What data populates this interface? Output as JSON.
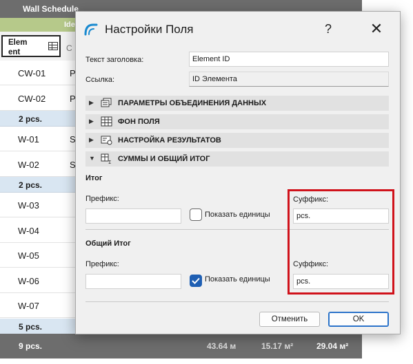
{
  "schedule": {
    "title": "Wall Schedule",
    "subheader_fragment": "Ide",
    "column_element": "Elem ent",
    "column_c_fragment": "C",
    "rows": [
      {
        "type": "item",
        "id": "CW-01",
        "c2": "P"
      },
      {
        "type": "item",
        "id": "CW-02",
        "c2": "P"
      },
      {
        "type": "group",
        "label": "2 pcs."
      },
      {
        "type": "item",
        "id": "W-01",
        "c2": "S"
      },
      {
        "type": "item",
        "id": "W-02",
        "c2": "S"
      },
      {
        "type": "group",
        "label": "2 pcs."
      },
      {
        "type": "item",
        "id": "W-03",
        "c2": ""
      },
      {
        "type": "item",
        "id": "W-04",
        "c2": ""
      },
      {
        "type": "item",
        "id": "W-05",
        "c2": ""
      },
      {
        "type": "item",
        "id": "W-06",
        "c2": ""
      },
      {
        "type": "item",
        "id": "W-07",
        "c2": ""
      },
      {
        "type": "group",
        "label": "5 pcs."
      }
    ],
    "total": {
      "count": "9 pcs.",
      "v1": "43.64 м",
      "v2": "15.17 м²",
      "v3": "29.04 м²"
    }
  },
  "dialog": {
    "title": "Настройки Поля",
    "help": "?",
    "close": "✕",
    "header_text_label": "Текст заголовка:",
    "header_text_value": "Element ID",
    "reference_label": "Ссылка:",
    "reference_value": "ID Элемента",
    "sections": [
      {
        "label": "ПАРАМЕТРЫ ОБЪЕДИНЕНИЯ ДАННЫХ",
        "icon": "merge-data-icon",
        "expanded": false
      },
      {
        "label": "ФОН ПОЛЯ",
        "icon": "grid-background-icon",
        "expanded": false
      },
      {
        "label": "НАСТРОЙКА РЕЗУЛЬТАТОВ",
        "icon": "results-settings-icon",
        "expanded": false
      },
      {
        "label": "СУММЫ И ОБЩИЙ ИТОГ",
        "icon": "sum-total-icon",
        "expanded": true
      }
    ],
    "subtotal": {
      "heading": "Итог",
      "prefix_label": "Префикс:",
      "prefix_value": "",
      "show_units_label": "Показать единицы",
      "show_units_checked": false,
      "suffix_label": "Суффикс:",
      "suffix_value": "pcs."
    },
    "grand_total": {
      "heading": "Общий Итог",
      "prefix_label": "Префикс:",
      "prefix_value": "",
      "show_units_label": "Показать единицы",
      "show_units_checked": true,
      "suffix_label": "Суффикс:",
      "suffix_value": "pcs."
    },
    "cancel_label": "Отменить",
    "ok_label": "OK"
  },
  "colors": {
    "highlight": "#d0121b",
    "accent": "#1f5fb3",
    "group_row": "#d9e6f2",
    "header_bar": "#6d6d6d"
  }
}
